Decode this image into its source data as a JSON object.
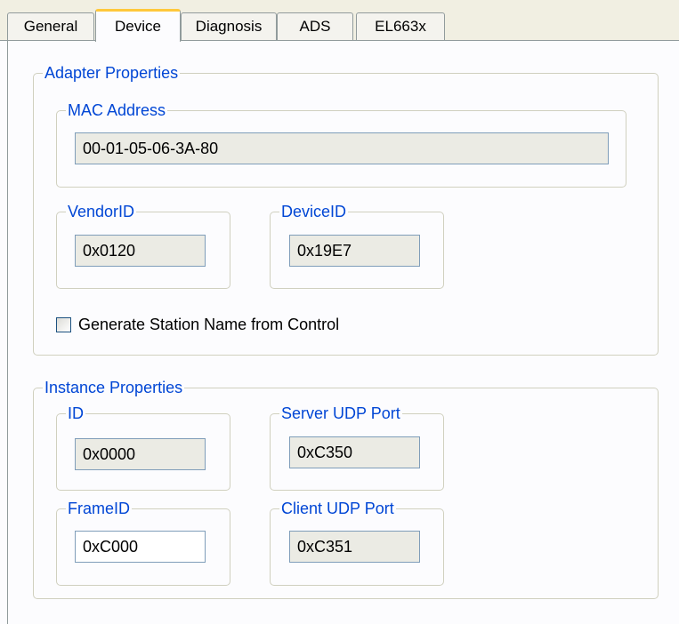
{
  "tabs": [
    {
      "label": "General",
      "active": false
    },
    {
      "label": "Device",
      "active": true
    },
    {
      "label": "Diagnosis",
      "active": false
    },
    {
      "label": "ADS",
      "active": false
    },
    {
      "label": "EL663x",
      "active": false
    }
  ],
  "adapter": {
    "title": "Adapter Properties",
    "mac": {
      "label": "MAC Address",
      "value": "00-01-05-06-3A-80"
    },
    "vendor": {
      "label": "VendorID",
      "value": "0x0120"
    },
    "device": {
      "label": "DeviceID",
      "value": "0x19E7"
    },
    "generate_station_name": {
      "label": "Generate Station Name from Control",
      "checked": false
    }
  },
  "instance": {
    "title": "Instance Properties",
    "id": {
      "label": "ID",
      "value": "0x0000"
    },
    "server_udp": {
      "label": "Server UDP Port",
      "value": "0xC350"
    },
    "frame_id": {
      "label": "FrameID",
      "value": "0xC000"
    },
    "client_udp": {
      "label": "Client UDP Port",
      "value": "0xC351"
    }
  },
  "colors": {
    "group_title": "#0046d5",
    "active_tab_highlight": "#ffc83c",
    "readonly_field_bg": "#ebebe4",
    "editable_field_bg": "#ffffff"
  }
}
